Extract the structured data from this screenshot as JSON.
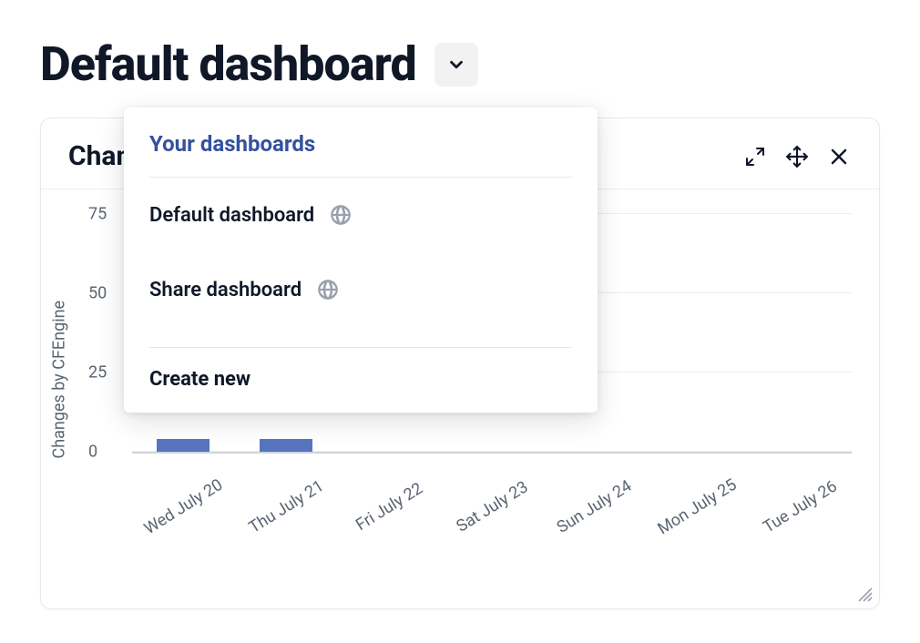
{
  "page": {
    "title": "Default dashboard"
  },
  "card": {
    "title": "Changes by CFEngine"
  },
  "dropdown": {
    "heading": "Your dashboards",
    "items": [
      {
        "label": "Default dashboard"
      },
      {
        "label": "Share dashboard"
      }
    ],
    "create": "Create new"
  },
  "chart_data": {
    "type": "bar",
    "ylabel": "Changes by CFEngine",
    "ylim": [
      0,
      80
    ],
    "yticks": [
      0,
      25,
      50,
      75
    ],
    "categories": [
      "Wed July 20",
      "Thu July 21",
      "Fri July 22",
      "Sat July 23",
      "Sun July 24",
      "Mon July 25",
      "Tue July 26"
    ],
    "values": [
      4,
      4,
      0,
      0,
      0,
      0,
      0
    ],
    "color": "#5774c0"
  }
}
